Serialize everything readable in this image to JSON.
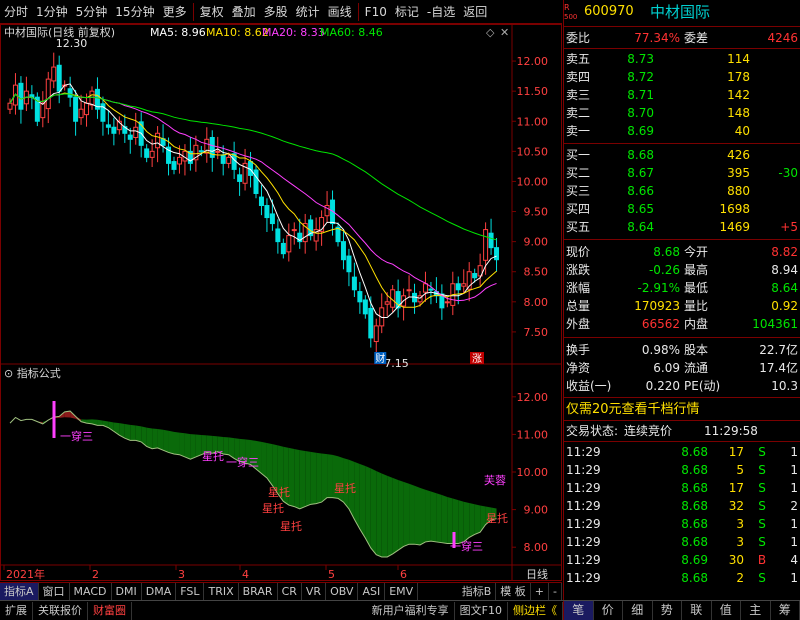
{
  "toolbar": {
    "items": [
      "分时",
      "1分钟",
      "5分钟",
      "15分钟",
      "更多",
      "复权",
      "叠加",
      "多股",
      "统计",
      "画线",
      "F10",
      "标记",
      "-自选",
      "返回"
    ]
  },
  "main": {
    "title": "中材国际(日线 前复权)",
    "ma5_label": "MA5: 8.96",
    "ma10_label": "MA10: 8.62",
    "ma20_label": "MA20: 8.33",
    "ma60_label": "MA60: 8.46",
    "high_mark": "12.30",
    "low_mark": "7.15",
    "tag_cai": "财",
    "tag_zhang": "涨",
    "yticks": [
      "12.00",
      "11.50",
      "11.00",
      "10.50",
      "10.00",
      "9.50",
      "9.00",
      "8.50",
      "8.00",
      "7.50"
    ]
  },
  "indicator": {
    "title": "指标公式",
    "yticks": [
      "12.00",
      "11.00",
      "10.00",
      "9.00",
      "8.00"
    ],
    "annotations": [
      "一穿三",
      "星托",
      "一穿三",
      "星托",
      "星托",
      "星托",
      "星托",
      "一穿三",
      "芙蓉",
      "星托"
    ]
  },
  "xaxis": {
    "labels": [
      "2021年",
      "2",
      "3",
      "4",
      "5",
      "6"
    ],
    "period": "日线"
  },
  "tabs": [
    "指标A",
    "窗口",
    "MACD",
    "DMI",
    "DMA",
    "FSL",
    "TRIX",
    "BRAR",
    "CR",
    "VR",
    "OBV",
    "ASI",
    "EMV",
    "指标B",
    "模 板",
    "+",
    "-"
  ],
  "statusbar": [
    "扩展",
    "关联报价",
    "财富圈",
    "新用户福利专享",
    "图文F10",
    "侧边栏《"
  ],
  "panel": {
    "code": "600970",
    "name": "中材国际",
    "r_badge": "R",
    "sub_badge": "500",
    "weibi_label": "委比",
    "weibi": "77.34%",
    "weicha_label": "委差",
    "weicha": "4246",
    "asks": [
      {
        "label": "卖五",
        "price": "8.73",
        "vol": "114"
      },
      {
        "label": "卖四",
        "price": "8.72",
        "vol": "178"
      },
      {
        "label": "卖三",
        "price": "8.71",
        "vol": "142"
      },
      {
        "label": "卖二",
        "price": "8.70",
        "vol": "148"
      },
      {
        "label": "卖一",
        "price": "8.69",
        "vol": "40"
      }
    ],
    "bids": [
      {
        "label": "买一",
        "price": "8.68",
        "vol": "426",
        "chg": ""
      },
      {
        "label": "买二",
        "price": "8.67",
        "vol": "395",
        "chg": "-30"
      },
      {
        "label": "买三",
        "price": "8.66",
        "vol": "880",
        "chg": ""
      },
      {
        "label": "买四",
        "price": "8.65",
        "vol": "1698",
        "chg": ""
      },
      {
        "label": "买五",
        "price": "8.64",
        "vol": "1469",
        "chg": "+5"
      }
    ],
    "quote": [
      {
        "l1": "现价",
        "v1": "8.68",
        "l2": "今开",
        "v2": "8.82",
        "c1": "green",
        "c2": "red"
      },
      {
        "l1": "涨跌",
        "v1": "-0.26",
        "l2": "最高",
        "v2": "8.94",
        "c1": "green",
        "c2": "white"
      },
      {
        "l1": "涨幅",
        "v1": "-2.91%",
        "l2": "最低",
        "v2": "8.64",
        "c1": "green",
        "c2": "green"
      },
      {
        "l1": "总量",
        "v1": "170923",
        "l2": "量比",
        "v2": "0.92",
        "c1": "yellow",
        "c2": "yellow"
      },
      {
        "l1": "外盘",
        "v1": "66562",
        "l2": "内盘",
        "v2": "104361",
        "c1": "red",
        "c2": "green"
      }
    ],
    "fund": [
      {
        "l1": "换手",
        "v1": "0.98%",
        "l2": "股本",
        "v2": "22.7亿"
      },
      {
        "l1": "净资",
        "v1": "6.09",
        "l2": "流通",
        "v2": "17.4亿"
      },
      {
        "l1": "收益(一)",
        "v1": "0.220",
        "l2": "PE(动)",
        "v2": "10.3"
      }
    ],
    "promo": "仅需20元查看千档行情",
    "trade_status_label": "交易状态:",
    "trade_status": "连续竞价",
    "trade_time": "11:29:58",
    "ticks": [
      {
        "t": "11:29",
        "p": "8.68",
        "v": "17",
        "s": "S",
        "n": "1"
      },
      {
        "t": "11:29",
        "p": "8.68",
        "v": "5",
        "s": "S",
        "n": "1"
      },
      {
        "t": "11:29",
        "p": "8.68",
        "v": "17",
        "s": "S",
        "n": "1"
      },
      {
        "t": "11:29",
        "p": "8.68",
        "v": "32",
        "s": "S",
        "n": "2"
      },
      {
        "t": "11:29",
        "p": "8.68",
        "v": "3",
        "s": "S",
        "n": "1"
      },
      {
        "t": "11:29",
        "p": "8.68",
        "v": "3",
        "s": "S",
        "n": "1"
      },
      {
        "t": "11:29",
        "p": "8.69",
        "v": "30",
        "s": "B",
        "n": "4"
      },
      {
        "t": "11:29",
        "p": "8.68",
        "v": "2",
        "s": "S",
        "n": "1"
      }
    ],
    "bottom_tabs": [
      "笔",
      "价",
      "细",
      "势",
      "联",
      "值",
      "主",
      "筹"
    ]
  },
  "chart_data": {
    "type": "candlestick",
    "title": "中材国际(日线 前复权)",
    "yaxis_main": [
      7.5,
      12.0
    ],
    "high": 12.3,
    "low": 7.15,
    "ma": [
      {
        "name": "MA5",
        "value": 8.96,
        "color": "#ffffff"
      },
      {
        "name": "MA10",
        "value": 8.62,
        "color": "#ffe000"
      },
      {
        "name": "MA20",
        "value": 8.33,
        "color": "#ff40ff"
      },
      {
        "name": "MA60",
        "value": 8.46,
        "color": "#00e600"
      }
    ],
    "months": [
      "2021年",
      "2",
      "3",
      "4",
      "5",
      "6"
    ],
    "closes": [
      11.3,
      11.6,
      11.2,
      11.5,
      11.4,
      11.0,
      11.3,
      11.7,
      11.9,
      11.5,
      11.6,
      11.4,
      11.0,
      11.2,
      11.3,
      11.5,
      11.2,
      11.0,
      10.9,
      10.8,
      11.0,
      10.8,
      10.7,
      10.9,
      10.6,
      10.4,
      10.5,
      10.8,
      10.6,
      10.3,
      10.2,
      10.4,
      10.5,
      10.3,
      10.6,
      10.5,
      10.7,
      10.4,
      10.5,
      10.3,
      10.4,
      10.2,
      10.0,
      10.3,
      10.1,
      9.8,
      9.6,
      9.4,
      9.3,
      9.0,
      8.8,
      9.1,
      9.2,
      9.0,
      9.3,
      9.1,
      9.2,
      9.4,
      9.6,
      9.3,
      9.0,
      8.7,
      8.5,
      8.2,
      8.0,
      7.8,
      7.4,
      7.6,
      7.9,
      8.0,
      8.2,
      7.9,
      8.1,
      8.2,
      8.0,
      8.1,
      8.3,
      8.2,
      8.1,
      7.9,
      8.0,
      8.3,
      8.2,
      8.3,
      8.5,
      8.4,
      8.6,
      9.2,
      8.9,
      8.7
    ]
  }
}
